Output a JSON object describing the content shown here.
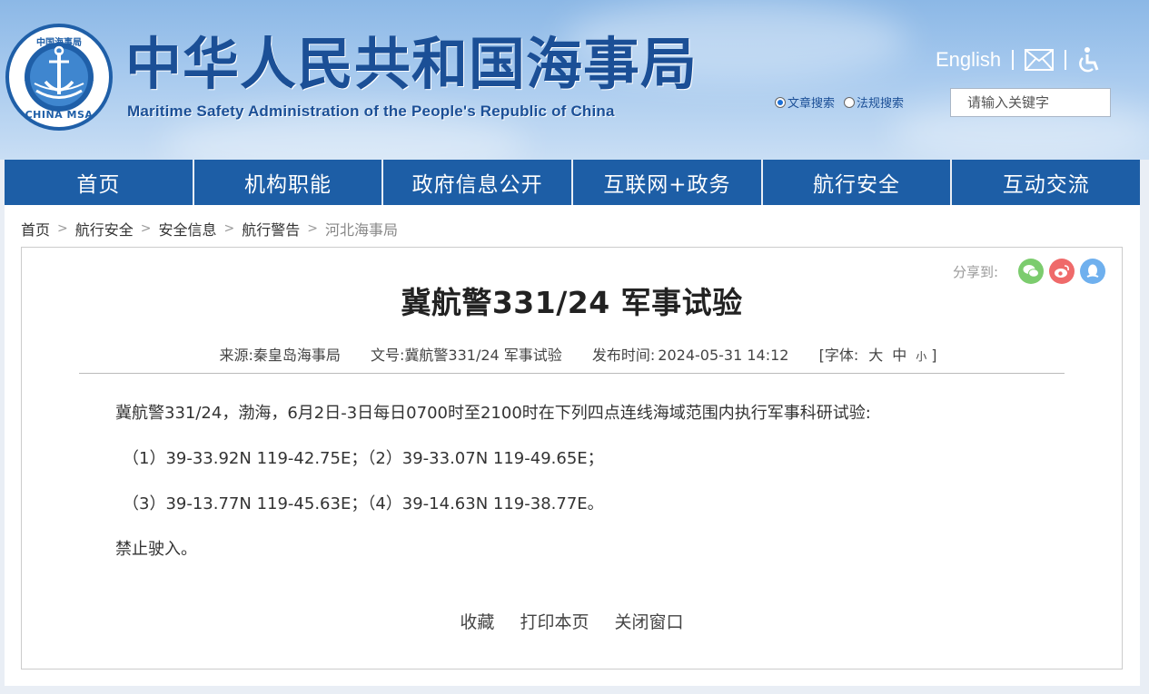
{
  "header": {
    "emblem_top_text": "中国海事局",
    "emblem_bottom_text": "CHINA MSA",
    "title": "中华人民共和国海事局",
    "subtitle": "Maritime Safety Administration of the People's Republic of China",
    "english_link": "English",
    "mail_icon": "mail-icon",
    "accessibility_icon": "accessibility-icon",
    "search_options": [
      "文章搜索",
      "法规搜索"
    ],
    "search_selected": "文章搜索",
    "search_placeholder": "请输入关键字"
  },
  "nav": {
    "items": [
      "首页",
      "机构职能",
      "政府信息公开",
      "互联网+政务",
      "航行安全",
      "互动交流"
    ]
  },
  "breadcrumb": [
    "首页",
    "航行安全",
    "安全信息",
    "航行警告",
    "河北海事局"
  ],
  "article": {
    "share_label": "分享到:",
    "share_icons": [
      "wechat-icon",
      "weibo-icon",
      "qq-icon"
    ],
    "title": "冀航警331/24 军事试验",
    "source_label": "来源:",
    "source": "秦皇岛海事局",
    "docno_label": "文号:",
    "docno": "冀航警331/24 军事试验",
    "date_label": "发布时间:",
    "date": "2024-05-31 14:12",
    "font_label": "[字体:",
    "font_large": "大",
    "font_medium": "中",
    "font_small": "小",
    "font_close": "]",
    "paragraphs": [
      "冀航警331/24，渤海，6月2日-3日每日0700时至2100时在下列四点连线海域范围内执行军事科研试验:",
      "（1）39-33.92N 119-42.75E；（2）39-33.07N 119-49.65E；",
      "（3）39-13.77N 119-45.63E；（4）39-14.63N 119-38.77E。",
      "禁止驶入。"
    ],
    "actions": [
      "收藏",
      "打印本页",
      "关闭窗口"
    ]
  },
  "colors": {
    "nav_blue": "#1d5ea6",
    "title_blue": "#1b4f96",
    "wechat": "#7ccc6e",
    "weibo": "#ef6a6a",
    "qq": "#6fb0ee"
  }
}
